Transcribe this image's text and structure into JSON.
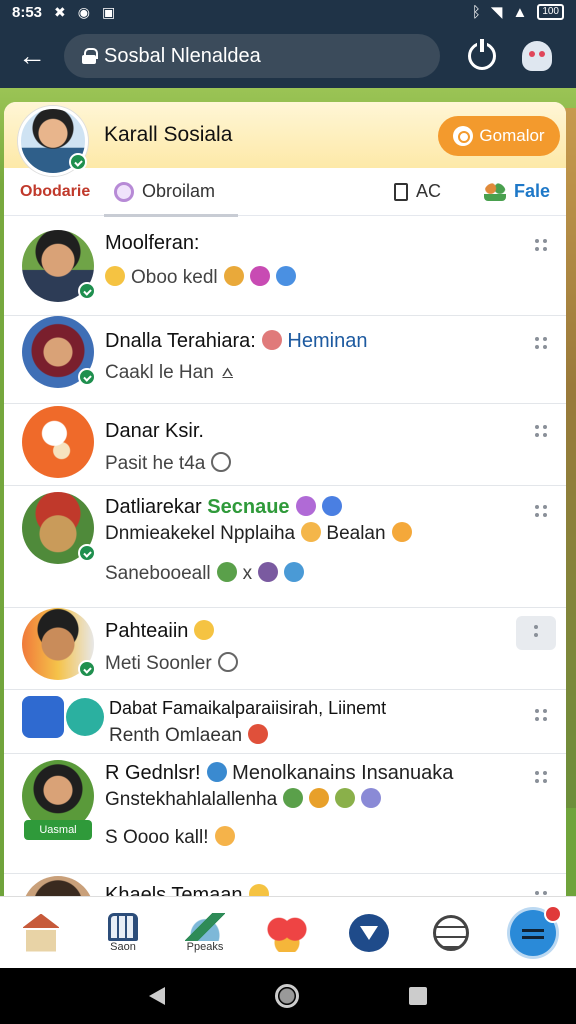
{
  "status_bar": {
    "time": "8:53",
    "icons": [
      "sync-icon",
      "target-icon",
      "notification-icon",
      "bluetooth-icon",
      "wifi-icon",
      "signal-icon",
      "battery-icon"
    ],
    "battery_label": "100"
  },
  "browser": {
    "url_text": "Sosbal Nlenaldea"
  },
  "header": {
    "profile_name": "Karall Sosiala",
    "primary_button": "Gomalor"
  },
  "tabs": [
    {
      "label": "Obodarie"
    },
    {
      "label": "Obroilam"
    },
    {
      "label": "AC"
    },
    {
      "label": "Fale"
    }
  ],
  "conversations": [
    {
      "name": "Moolferan:",
      "line1": "Oboo kedl",
      "line2": ""
    },
    {
      "name": "Dnalla Terahiara:",
      "name_suffix": "Heminan",
      "line1": "Caakl le Han",
      "line2": ""
    },
    {
      "name": "Danar Ksir.",
      "line1": "Pasit he t4a",
      "line2": ""
    },
    {
      "name": "Datliarekar",
      "name_suffix": "Secnaue",
      "line1": "Dnmieakekel Npplaiha",
      "line1_suffix": "Bealan",
      "line2": "Sanebooeall"
    },
    {
      "name": "Pahteaiin",
      "line1": "Meti Soonler",
      "line2": ""
    },
    {
      "name": "Dabat Famaikalparaiisirah, Liinemt",
      "line1": "Renth Omlaean",
      "line2": ""
    },
    {
      "name": "R Gednlsr!",
      "name_suffix": "Menolkanains Insanuaka",
      "line1": "Gnstekhahlalallenha",
      "line2": "S Oooo kall!",
      "badge": "Uasmal"
    },
    {
      "name": "Khaels Temaan",
      "line1": "",
      "line2": ""
    }
  ],
  "bottom_nav": [
    {
      "label": "",
      "icon": "house-icon"
    },
    {
      "label": "Saon",
      "icon": "shop-icon"
    },
    {
      "label": "Ppeaks",
      "icon": "pen-icon"
    },
    {
      "label": "",
      "icon": "heart-gift-icon"
    },
    {
      "label": "",
      "icon": "filter-icon"
    },
    {
      "label": "",
      "icon": "chat-icon"
    },
    {
      "label": "",
      "icon": "compose-fab-icon"
    }
  ],
  "colors": {
    "primary_orange": "#f39a2d",
    "header_bar": "#1f3347",
    "online_green": "#1f8f4e",
    "tab_active_red": "#c0392b",
    "tab_blue": "#1e78c8"
  }
}
